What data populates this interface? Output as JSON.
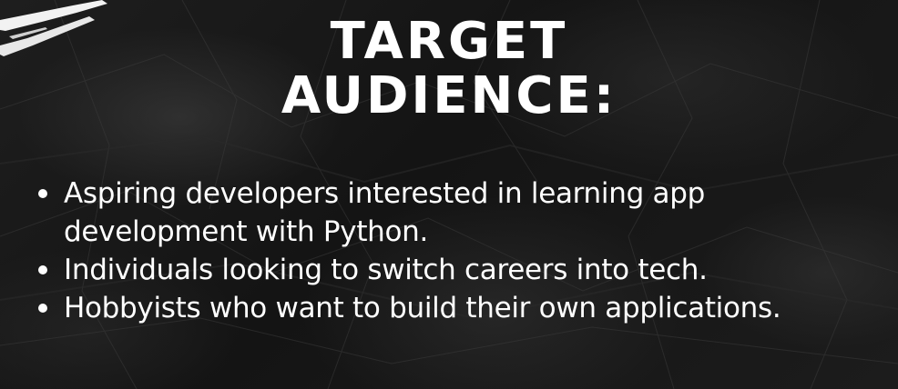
{
  "title": {
    "line1": "TARGET",
    "line2": "AUDIENCE:"
  },
  "bullets": [
    {
      "text": "Aspiring developers interested in learning app development with Python."
    },
    {
      "text": "Individuals looking to switch careers into tech."
    },
    {
      "text": "Hobbyists who want to build their own applications."
    }
  ],
  "colors": {
    "background": "#171717",
    "text": "#ffffff"
  }
}
